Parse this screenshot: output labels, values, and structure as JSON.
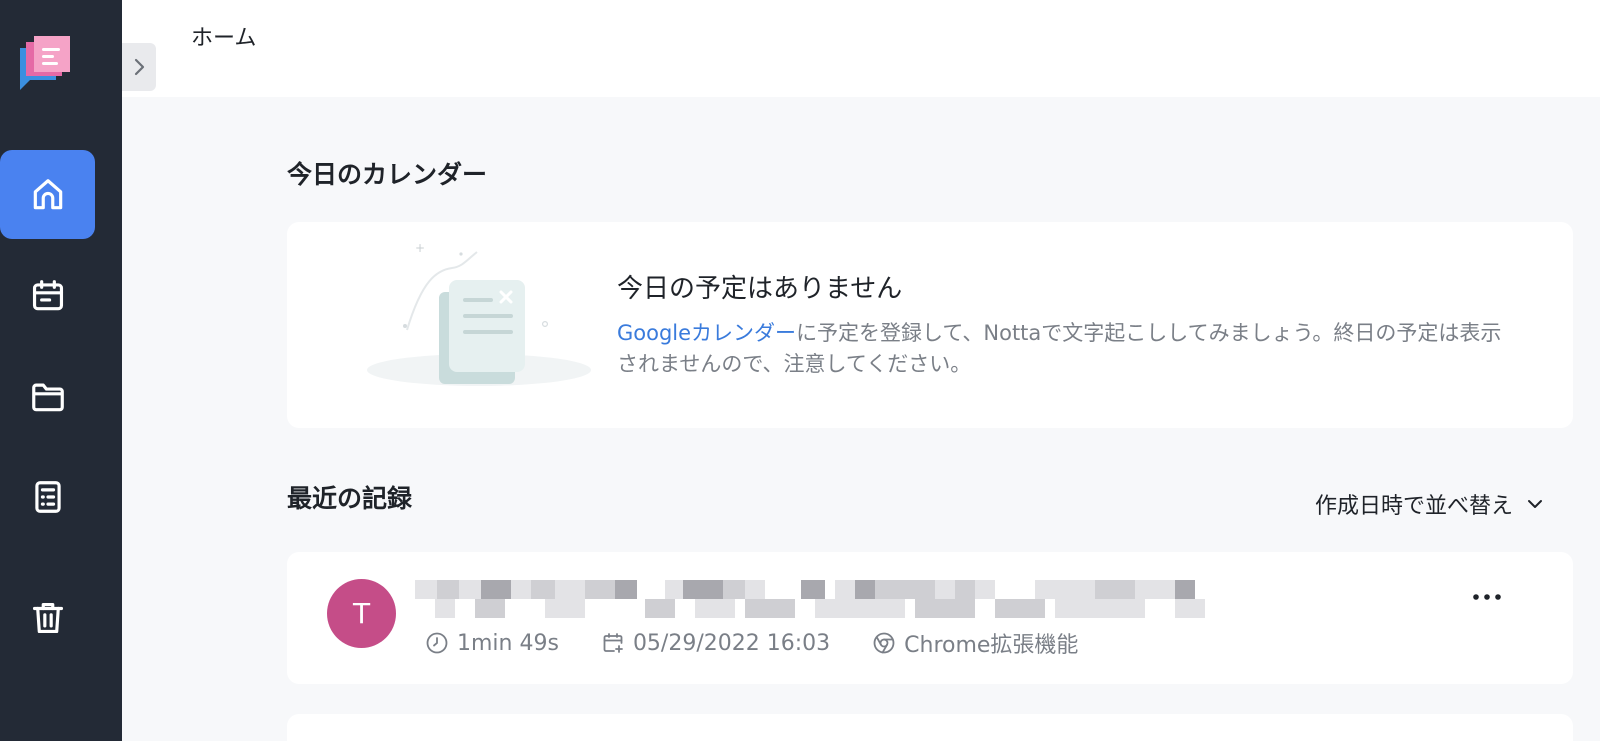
{
  "header": {
    "breadcrumb": "ホーム"
  },
  "sidebar": {
    "items": [
      {
        "icon": "home-icon",
        "active": true
      },
      {
        "icon": "calendar-icon",
        "active": false
      },
      {
        "icon": "folder-icon",
        "active": false
      },
      {
        "icon": "calculator-icon",
        "active": false
      },
      {
        "icon": "trash-icon",
        "active": false
      }
    ]
  },
  "calendar_section": {
    "title": "今日のカレンダー",
    "empty_title": "今日の予定はありません",
    "link_text": "Googleカレンダー",
    "desc_rest": "に予定を登録して、Nottaで文字起こししてみましょう。終日の予定は表示されませんので、注意してください。"
  },
  "recent_section": {
    "title": "最近の記録",
    "sort_label": "作成日時で並べ替え",
    "records": [
      {
        "avatar_letter": "T",
        "duration": "1min 49s",
        "date": "05/29/2022 16:03",
        "source": "Chrome拡張機能"
      }
    ]
  },
  "colors": {
    "sidebar_bg": "#232a36",
    "accent": "#4a82f0",
    "link": "#3a7bdc",
    "avatar": "#c54d88"
  }
}
